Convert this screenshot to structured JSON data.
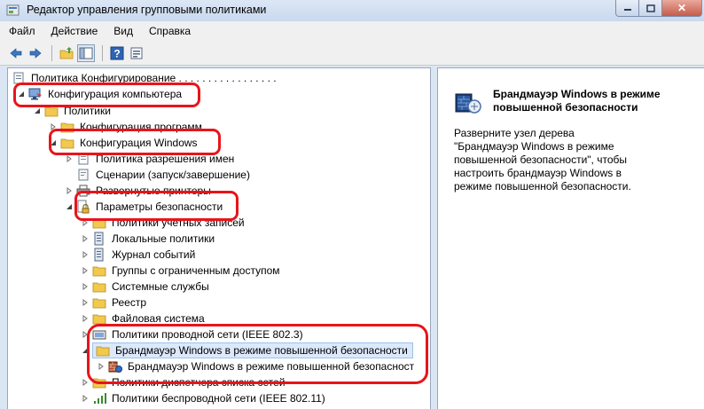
{
  "window": {
    "title": "Редактор управления групповыми политиками",
    "close_label": "✕"
  },
  "menu": [
    "Файл",
    "Действие",
    "Вид",
    "Справка"
  ],
  "toolbar": {
    "back_icon": "back-arrow-icon",
    "forward_icon": "forward-arrow-icon",
    "up_icon": "up-folder-icon",
    "show_tree_icon": "show-hide-tree-icon",
    "help_icon": "help-icon",
    "properties_icon": "properties-icon",
    "help_glyph": "?"
  },
  "tree": {
    "root": "Политика Конфигурирование . . . . . . . . .  . . . . . . . .",
    "computer_config": "Конфигурация компьютера",
    "policies": "Политики",
    "software_config": "Конфигурация программ",
    "windows_config": "Конфигурация Windows",
    "name_resolution": "Политика разрешения имен",
    "scripts": "Сценарии (запуск/завершение)",
    "deployed_printers": "Развернутые принтеры",
    "security_settings": "Параметры безопасности",
    "account_policies": "Политики учетных записей",
    "local_policies": "Локальные политики",
    "event_log": "Журнал событий",
    "restricted_groups": "Группы с ограниченным доступом",
    "system_services": "Системные службы",
    "registry": "Реестр",
    "file_system": "Файловая система",
    "wired_network": "Политики проводной сети (IEEE 802.3)",
    "firewall_advanced": "Брандмауэр Windows в режиме повышенной безопасности",
    "firewall_child": "Брандмауэр Windows в режиме повышенной безопасност",
    "network_list": "Политики диспетчера списка сетей",
    "wireless_network": "Политики беспроводной сети (IEEE 802.11)"
  },
  "details": {
    "title": "Брандмауэр Windows в режиме повышенной безопасности",
    "text": "Разверните узел дерева \"Брандмауэр Windows в режиме повышенной безопасности\", чтобы настроить брандмауэр Windows в режиме повышенной безопасности."
  },
  "colors": {
    "annotation_red": "#e8141b",
    "selection_bg": "#dbe9fb",
    "folder_yellow": "#f2c94c"
  }
}
